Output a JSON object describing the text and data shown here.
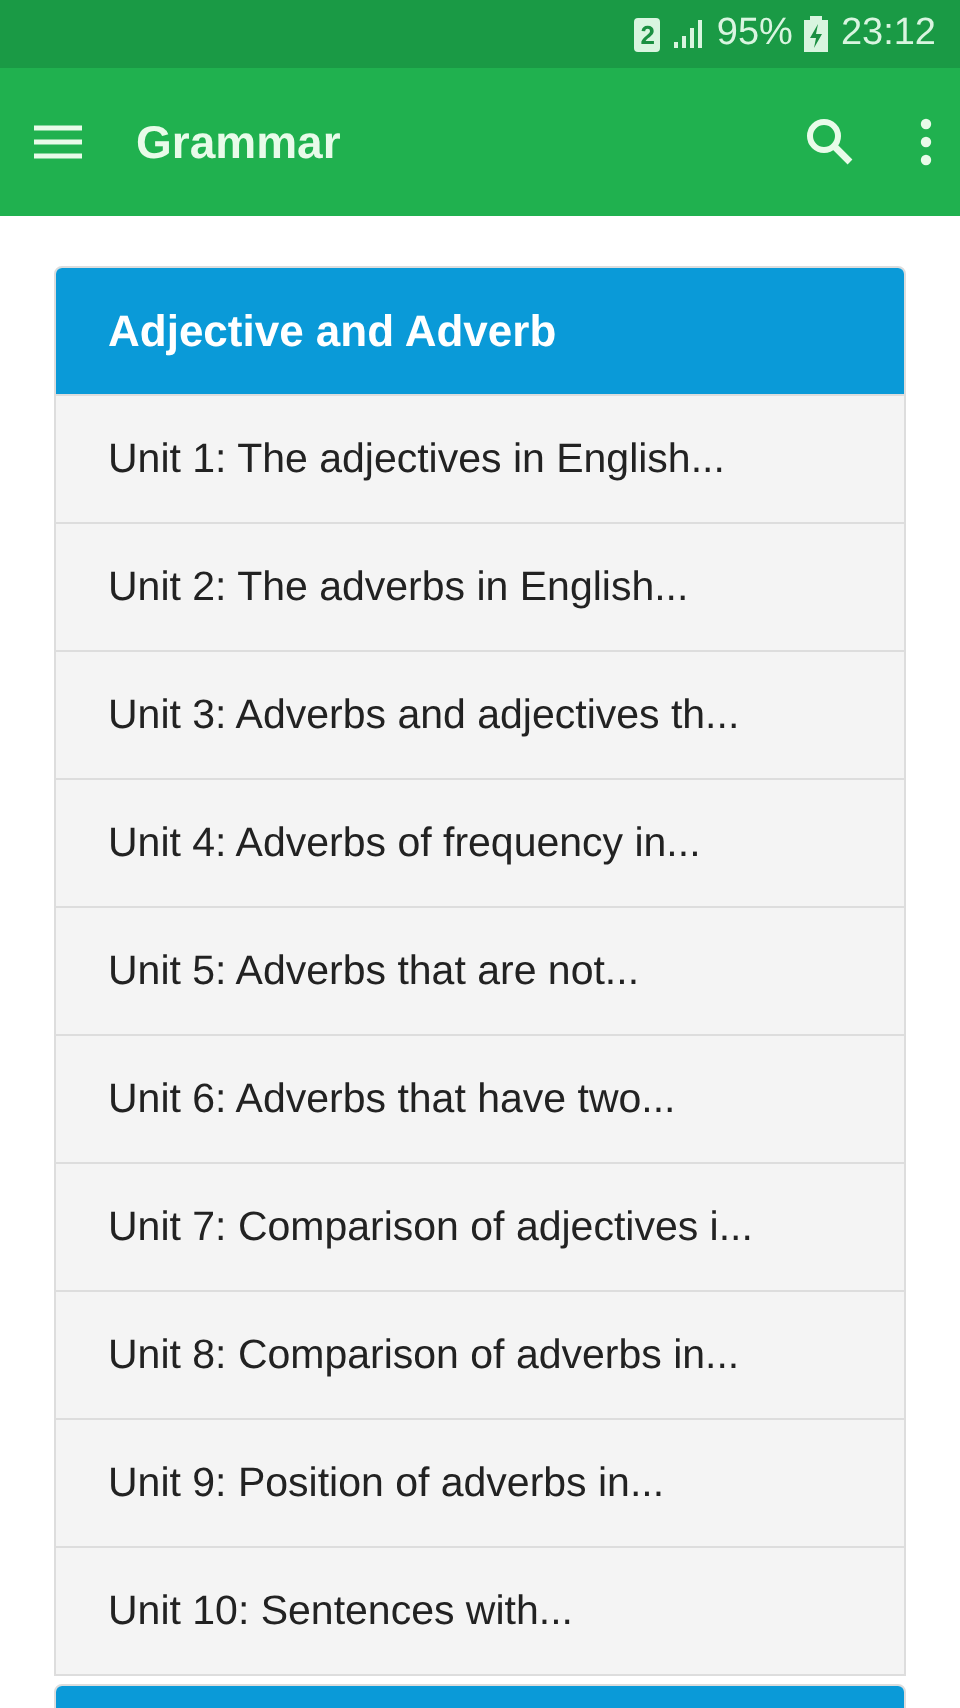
{
  "status_bar": {
    "sim": "2",
    "battery": "95%",
    "time": "23:12"
  },
  "app_bar": {
    "title": "Grammar"
  },
  "sections": [
    {
      "kind": "section",
      "title": "Adjective and Adverb",
      "items": [
        {
          "label": "Unit 1: The adjectives in English..."
        },
        {
          "label": "Unit 2: The adverbs in English..."
        },
        {
          "label": "Unit 3: Adverbs and adjectives th..."
        },
        {
          "label": "Unit 4: Adverbs of frequency in..."
        },
        {
          "label": "Unit 5: Adverbs that are not..."
        },
        {
          "label": "Unit 6: Adverbs that have two..."
        },
        {
          "label": "Unit 7: Comparison of adjectives i..."
        },
        {
          "label": "Unit 8: Comparison of adverbs in..."
        },
        {
          "label": "Unit 9: Position of adverbs in..."
        },
        {
          "label": "Unit 10: Sentences with..."
        }
      ]
    },
    {
      "kind": "section"
    }
  ]
}
